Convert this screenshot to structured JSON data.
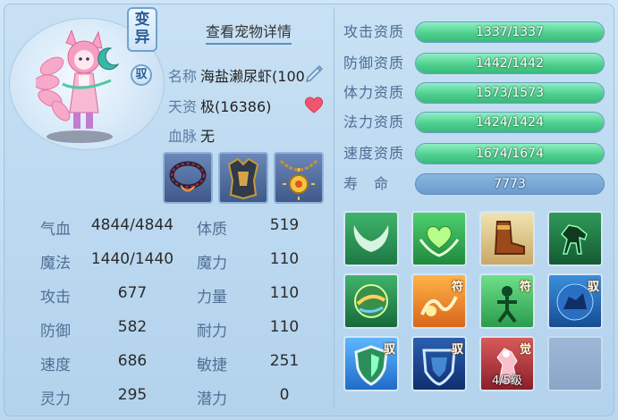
{
  "pet": {
    "badge_variant": "变异",
    "badge_variant_top": "变",
    "badge_variant_bottom": "异",
    "badge_tame": "驭",
    "detail_link": "查看宠物详情",
    "name_label": "名称",
    "name_value": "海盐濑尿虾(100",
    "talent_label": "天资",
    "talent_value": "极(16386)",
    "bloodline_label": "血脉",
    "bloodline_value": "无"
  },
  "equipment": [
    {
      "name": "necklace-red-icon"
    },
    {
      "name": "armor-icon"
    },
    {
      "name": "amulet-gold-icon"
    }
  ],
  "stats": [
    {
      "l1": "气血",
      "v1": "4844/4844",
      "l2": "体质",
      "v2": "519"
    },
    {
      "l1": "魔法",
      "v1": "1440/1440",
      "l2": "魔力",
      "v2": "110"
    },
    {
      "l1": "攻击",
      "v1": "677",
      "l2": "力量",
      "v2": "110"
    },
    {
      "l1": "防御",
      "v1": "582",
      "l2": "耐力",
      "v2": "110"
    },
    {
      "l1": "速度",
      "v1": "686",
      "l2": "敏捷",
      "v2": "251"
    },
    {
      "l1": "灵力",
      "v1": "295",
      "l2": "潜力",
      "v2": "0"
    }
  ],
  "aptitudes": [
    {
      "label": "攻击资质",
      "value": "1337/1337",
      "fill": 1.0
    },
    {
      "label": "防御资质",
      "value": "1442/1442",
      "fill": 1.0
    },
    {
      "label": "体力资质",
      "value": "1573/1573",
      "fill": 1.0
    },
    {
      "label": "法力资质",
      "value": "1424/1424",
      "fill": 1.0
    },
    {
      "label": "速度资质",
      "value": "1674/1674",
      "fill": 1.0
    }
  ],
  "lifespan": {
    "label": "寿　命",
    "value": "7773"
  },
  "skills": [
    {
      "name": "wings-skill-icon",
      "tag": ""
    },
    {
      "name": "heart-skill-icon",
      "tag": ""
    },
    {
      "name": "boot-skill-icon",
      "tag": ""
    },
    {
      "name": "horse-skill-icon",
      "tag": ""
    },
    {
      "name": "orb-skill-icon",
      "tag": ""
    },
    {
      "name": "rune-fire-skill-icon",
      "tag": "符"
    },
    {
      "name": "rune-figure-skill-icon",
      "tag": "符"
    },
    {
      "name": "beast-blue-skill-icon",
      "tag": "驭"
    },
    {
      "name": "shield-skill-icon",
      "tag": "驭"
    },
    {
      "name": "barrier-skill-icon",
      "tag": "驭"
    },
    {
      "name": "awaken-skill-icon",
      "tag": "觉",
      "level": "4/5级"
    },
    {
      "name": "empty-skill-slot",
      "tag": ""
    }
  ],
  "colors": {
    "bar_green": "#4fd08f",
    "label_blue": "#4f6f95"
  }
}
